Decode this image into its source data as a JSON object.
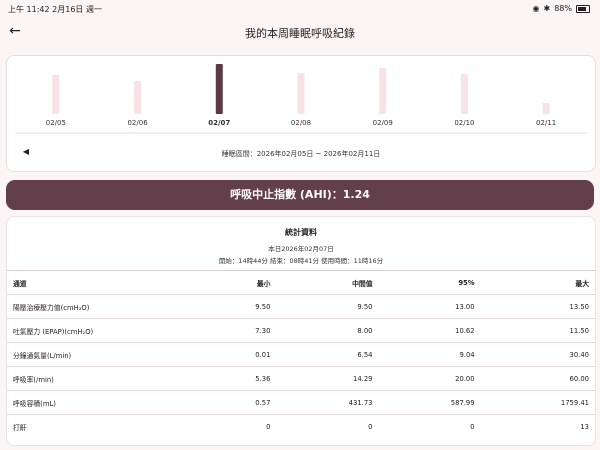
{
  "status_bar": {
    "time_date": "上午 11:42   2月16日 週一",
    "battery": "88%",
    "icons": [
      "wifi-icon",
      "bluetooth-icon",
      "battery-icon"
    ]
  },
  "header": {
    "title": "我的本周睡眠呼吸紀錄",
    "back_icon": "arrow-left-icon"
  },
  "week_chart": {
    "days": [
      "02/05",
      "02/06",
      "02/07",
      "02/08",
      "02/09",
      "02/10",
      "02/11"
    ],
    "selected": "02/07",
    "values": [
      0.78,
      0.66,
      1.0,
      0.82,
      0.92,
      0.8,
      0.22
    ],
    "bar_color": "#f8e2e6",
    "selected_color": "#5b3a45",
    "range_label": "睡眠區間：2026年02月05日 ~ 2026年02月11日",
    "prev_icon": "triangle-left-icon"
  },
  "ahi": {
    "label": "呼吸中止指數 (AHI)：1.24",
    "color": "#633f4c"
  },
  "stats": {
    "title": "統計資料",
    "date": "本日2026年02月07日",
    "info": "開始：14時44分  結束：08時41分  使用時間：11時16分",
    "columns": [
      "通道",
      "最小",
      "中間值",
      "95%",
      "最大"
    ],
    "rows": [
      [
        "陽壓治療壓力值(cmH₂O)",
        "9.50",
        "9.50",
        "13.00",
        "13.50"
      ],
      [
        "吐氣壓力 (EPAP)(cmH₂O)",
        "7.30",
        "8.00",
        "10.62",
        "11.50"
      ],
      [
        "分鐘通氣量(L/min)",
        "0.01",
        "6.54",
        "9.04",
        "30.40"
      ],
      [
        "呼吸率(/min)",
        "5.36",
        "14.29",
        "20.00",
        "60.00"
      ],
      [
        "呼吸容積(mL)",
        "0.57",
        "431.73",
        "587.99",
        "1759.41"
      ],
      [
        "打鼾",
        "0",
        "0",
        "0",
        "13"
      ]
    ]
  }
}
